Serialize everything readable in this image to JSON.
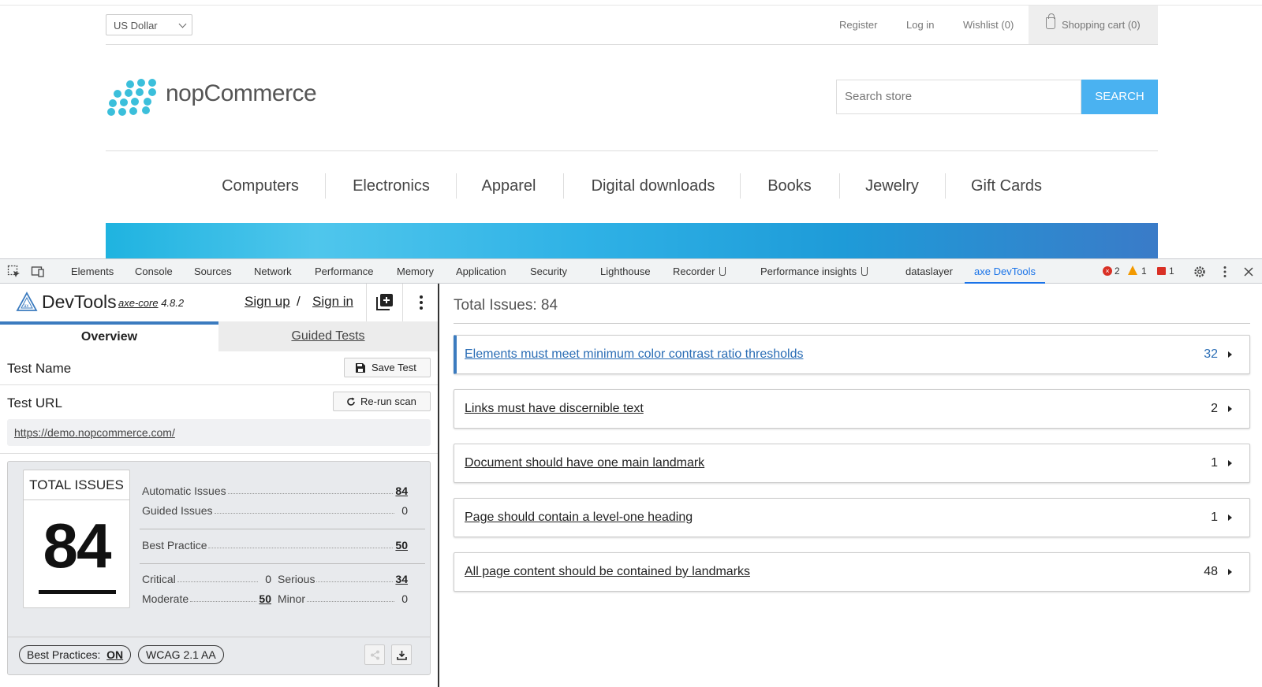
{
  "site": {
    "currency": "US Dollar",
    "header_links": [
      "Register",
      "Log in",
      "Wishlist (0)"
    ],
    "cart": "Shopping cart (0)",
    "logo_text": "nopCommerce",
    "search_placeholder": "Search store",
    "search_button": "SEARCH",
    "categories": [
      "Computers",
      "Electronics",
      "Apparel",
      "Digital downloads",
      "Books",
      "Jewelry",
      "Gift Cards"
    ],
    "brand_color": "#4ab2f1"
  },
  "devtools": {
    "tabs": [
      "Elements",
      "Console",
      "Sources",
      "Network",
      "Performance",
      "Memory",
      "Application",
      "Security",
      "Lighthouse",
      "Recorder",
      "Performance insights",
      "dataslayer",
      "axe DevTools"
    ],
    "active_tab": "axe DevTools",
    "errors": "2",
    "warnings": "1",
    "issues": "1"
  },
  "axe": {
    "title": "DevTools",
    "core_label": "axe-core",
    "version": "4.8.2",
    "sign_up": "Sign up",
    "auth_sep": "/",
    "sign_in": "Sign in",
    "tab_overview": "Overview",
    "tab_guided": "Guided Tests",
    "test_name_label": "Test Name",
    "save_test": "Save Test",
    "test_url_label": "Test URL",
    "rerun": "Re-run scan",
    "url": "https://demo.nopcommerce.com/",
    "total_issues_label": "TOTAL ISSUES",
    "total_issues": "84",
    "automatic_issues_label": "Automatic Issues",
    "automatic_issues": "84",
    "guided_issues_label": "Guided Issues",
    "guided_issues": "0",
    "best_practice_label": "Best Practice",
    "best_practice": "50",
    "critical_label": "Critical",
    "critical": "0",
    "serious_label": "Serious",
    "serious": "34",
    "moderate_label": "Moderate",
    "moderate": "50",
    "minor_label": "Minor",
    "minor": "0",
    "best_practices_pill_label": "Best Practices:",
    "best_practices_pill_value": "ON",
    "wcag_pill": "WCAG 2.1 AA",
    "accent_color": "#3b7bbf"
  },
  "results": {
    "heading": "Total Issues: 84",
    "issues": [
      {
        "title": "Elements must meet minimum color contrast ratio thresholds",
        "count": "32"
      },
      {
        "title": "Links must have discernible text",
        "count": "2"
      },
      {
        "title": "Document should have one main landmark",
        "count": "1"
      },
      {
        "title": "Page should contain a level-one heading",
        "count": "1"
      },
      {
        "title": "All page content should be contained by landmarks",
        "count": "48"
      }
    ]
  }
}
